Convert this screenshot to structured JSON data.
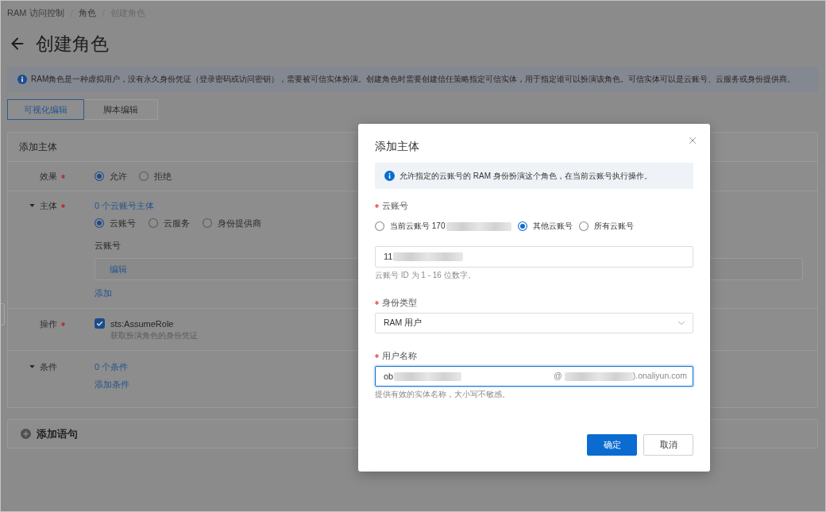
{
  "breadcrumb": [
    {
      "label": "RAM 访问控制"
    },
    {
      "label": "角色"
    },
    {
      "label": "创建角色"
    }
  ],
  "page_title": "创建角色",
  "notice": "RAM角色是一种虚拟用户，没有永久身份凭证（登录密码或访问密钥），需要被可信实体扮演。创建角色时需要创建信任策略指定可信实体，用于指定谁可以扮演该角色。可信实体可以是云账号、云服务或身份提供商。",
  "tabs": [
    {
      "label": "可视化编辑",
      "selected": true
    },
    {
      "label": "脚本编辑",
      "selected": false
    }
  ],
  "statement": {
    "title": "添加主体",
    "fields": [
      {
        "kind": "radio",
        "label": "效果",
        "required": true,
        "options": [
          {
            "label": "允许",
            "selected": true
          },
          {
            "label": "拒绝",
            "selected": false
          }
        ]
      },
      {
        "kind": "principal",
        "label": "主体",
        "required": true,
        "expanded": true,
        "summary": "0 个云账号主体",
        "options": [
          {
            "label": "云账号",
            "selected": true
          },
          {
            "label": "云服务",
            "selected": false
          },
          {
            "label": "身份提供商",
            "selected": false
          }
        ],
        "list_label": "云账号",
        "edit_link": "编辑",
        "add_link": "添加"
      },
      {
        "kind": "checkbox",
        "label": "操作",
        "required": true,
        "checked": true,
        "name": "sts:AssumeRole",
        "description": "获取扮演角色的身份凭证"
      },
      {
        "kind": "condition",
        "label": "条件",
        "required": false,
        "expanded": true,
        "summary": "0 个条件",
        "add_link": "添加条件"
      }
    ]
  },
  "add_statement": "添加语句",
  "dialog": {
    "title": "添加主体",
    "notice": "允许指定的云账号的 RAM 身份扮演这个角色，在当前云账号执行操作。",
    "fields": [
      {
        "kind": "account",
        "label": "云账号",
        "required": true,
        "options": [
          {
            "label": "当前云账号 170",
            "redacted": true,
            "selected": false
          },
          {
            "label": "其他云账号",
            "redacted": false,
            "selected": true
          },
          {
            "label": "所有云账号",
            "redacted": false,
            "selected": false
          }
        ],
        "value": "11",
        "value_redacted": true,
        "hint": "云账号 ID 为 1 - 16 位数字。"
      },
      {
        "kind": "select",
        "label": "身份类型",
        "required": true,
        "value": "RAM 用户"
      },
      {
        "kind": "text",
        "label": "用户名称",
        "required": true,
        "focused": true,
        "value": "ob",
        "value_redacted": true,
        "suffix": [
          {
            "text": "@",
            "redacted": true
          },
          {
            "text": ").onaliyun.com",
            "redacted": false
          }
        ],
        "hint": "提供有效的实体名称，大小写不敏感。"
      }
    ],
    "buttons": [
      {
        "label": "确定",
        "kind": "primary"
      },
      {
        "label": "取消",
        "kind": "secondary"
      }
    ]
  }
}
